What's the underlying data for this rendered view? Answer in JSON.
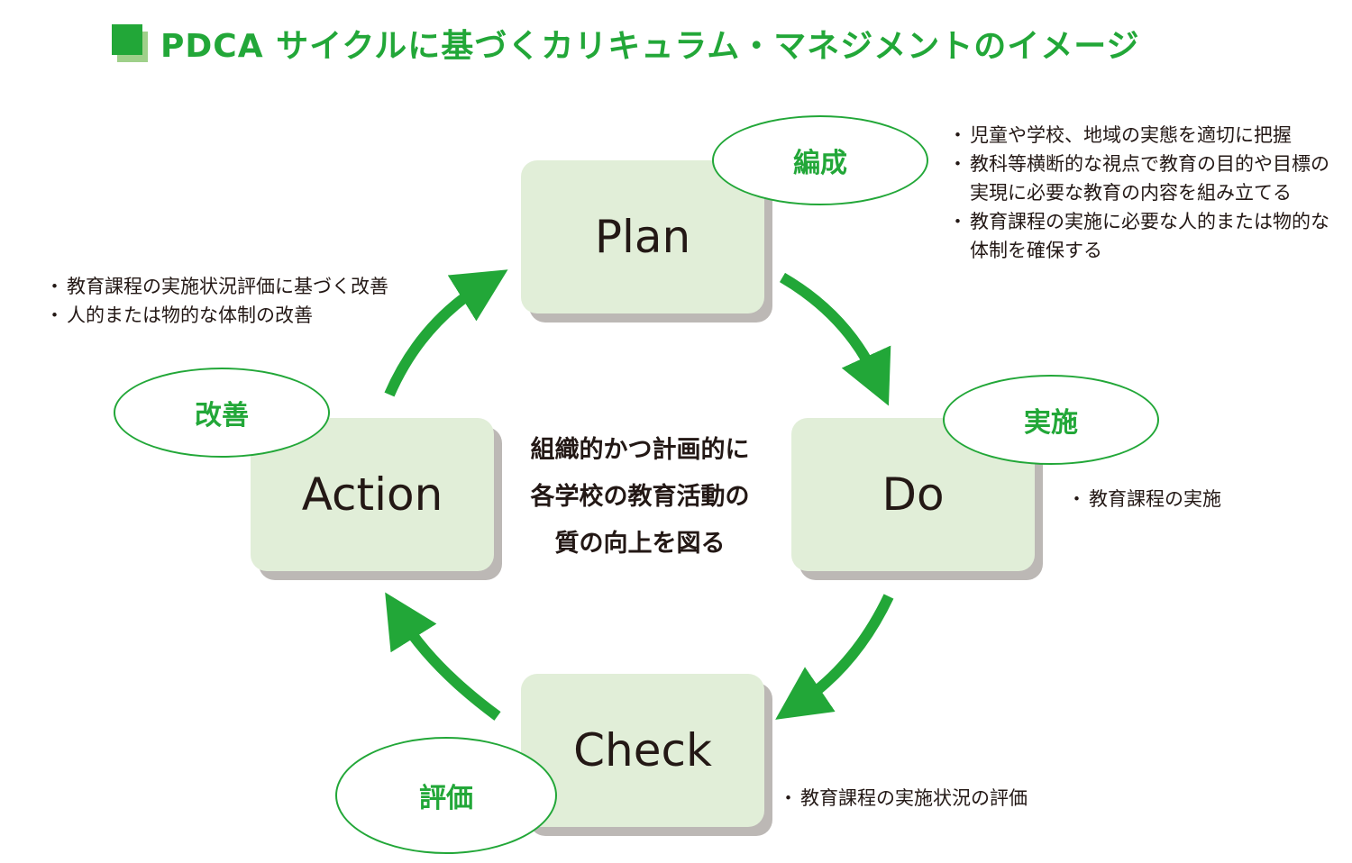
{
  "title": {
    "text": "PDCA サイクルに基づくカリキュラム・マネジメントのイメージ",
    "icon": "green-square-bullet-icon"
  },
  "colors": {
    "accent": "#22a738",
    "box_fill": "#e1eed8",
    "box_shadow": "#bcb8b5",
    "text": "#231815"
  },
  "center": {
    "lines": [
      "組織的かつ計画的に",
      "各学校の教育活動の",
      "質の向上を図る"
    ]
  },
  "stages": {
    "plan": {
      "label": "Plan",
      "tag": "編成",
      "notes": [
        "児童や学校、地域の実態を適切に把握",
        "教科等横断的な視点で教育の目的や目標の実現に必要な教育の内容を組み立てる",
        "教育課程の実施に必要な人的または物的な体制を確保する"
      ]
    },
    "do": {
      "label": "Do",
      "tag": "実施",
      "notes": [
        "教育課程の実施"
      ]
    },
    "check": {
      "label": "Check",
      "tag": "評価",
      "notes": [
        "教育課程の実施状況の評価"
      ]
    },
    "action": {
      "label": "Action",
      "tag": "改善",
      "notes": [
        "教育課程の実施状況評価に基づく改善",
        "人的または物的な体制の改善"
      ]
    }
  },
  "arrows": [
    {
      "from": "Plan",
      "to": "Do"
    },
    {
      "from": "Do",
      "to": "Check"
    },
    {
      "from": "Check",
      "to": "Action"
    },
    {
      "from": "Action",
      "to": "Plan"
    }
  ]
}
